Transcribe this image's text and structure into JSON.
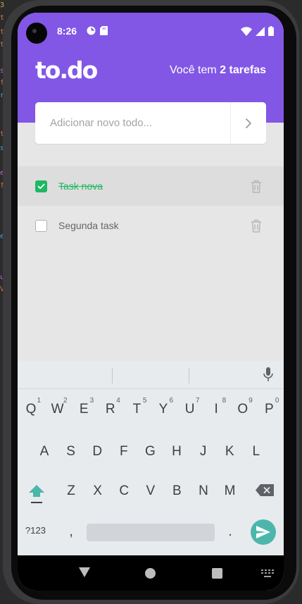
{
  "status_bar": {
    "time": "8:26"
  },
  "header": {
    "logo": "to.do",
    "summary_prefix": "Você tem ",
    "summary_count": "2 tarefas",
    "accent_color": "#8257e5"
  },
  "new_todo": {
    "placeholder": "Adicionar novo todo...",
    "value": ""
  },
  "tasks": [
    {
      "title": "Task nova",
      "done": true
    },
    {
      "title": "Segunda task",
      "done": false
    }
  ],
  "keyboard": {
    "row1": [
      {
        "key": "Q",
        "hint": "1"
      },
      {
        "key": "W",
        "hint": "2"
      },
      {
        "key": "E",
        "hint": "3"
      },
      {
        "key": "R",
        "hint": "4"
      },
      {
        "key": "T",
        "hint": "5"
      },
      {
        "key": "Y",
        "hint": "6"
      },
      {
        "key": "U",
        "hint": "7"
      },
      {
        "key": "I",
        "hint": "8"
      },
      {
        "key": "O",
        "hint": "9"
      },
      {
        "key": "P",
        "hint": "0"
      }
    ],
    "row2": [
      "A",
      "S",
      "D",
      "F",
      "G",
      "H",
      "J",
      "K",
      "L"
    ],
    "row3": [
      "Z",
      "X",
      "C",
      "V",
      "B",
      "N",
      "M"
    ],
    "symbols_label": "?123",
    "comma": ",",
    "period": ".",
    "send_color": "#4db6ac"
  },
  "icons": {
    "submit": "chevron-right-icon",
    "delete": "trash-icon",
    "mic": "mic-icon",
    "shift": "shift-icon",
    "backspace": "backspace-icon",
    "send": "send-icon",
    "nav_back": "back-triangle-icon",
    "nav_home": "home-circle-icon",
    "nav_recents": "recents-square-icon"
  },
  "colors": {
    "done": "#1db863",
    "background": "#e6e6e6"
  }
}
